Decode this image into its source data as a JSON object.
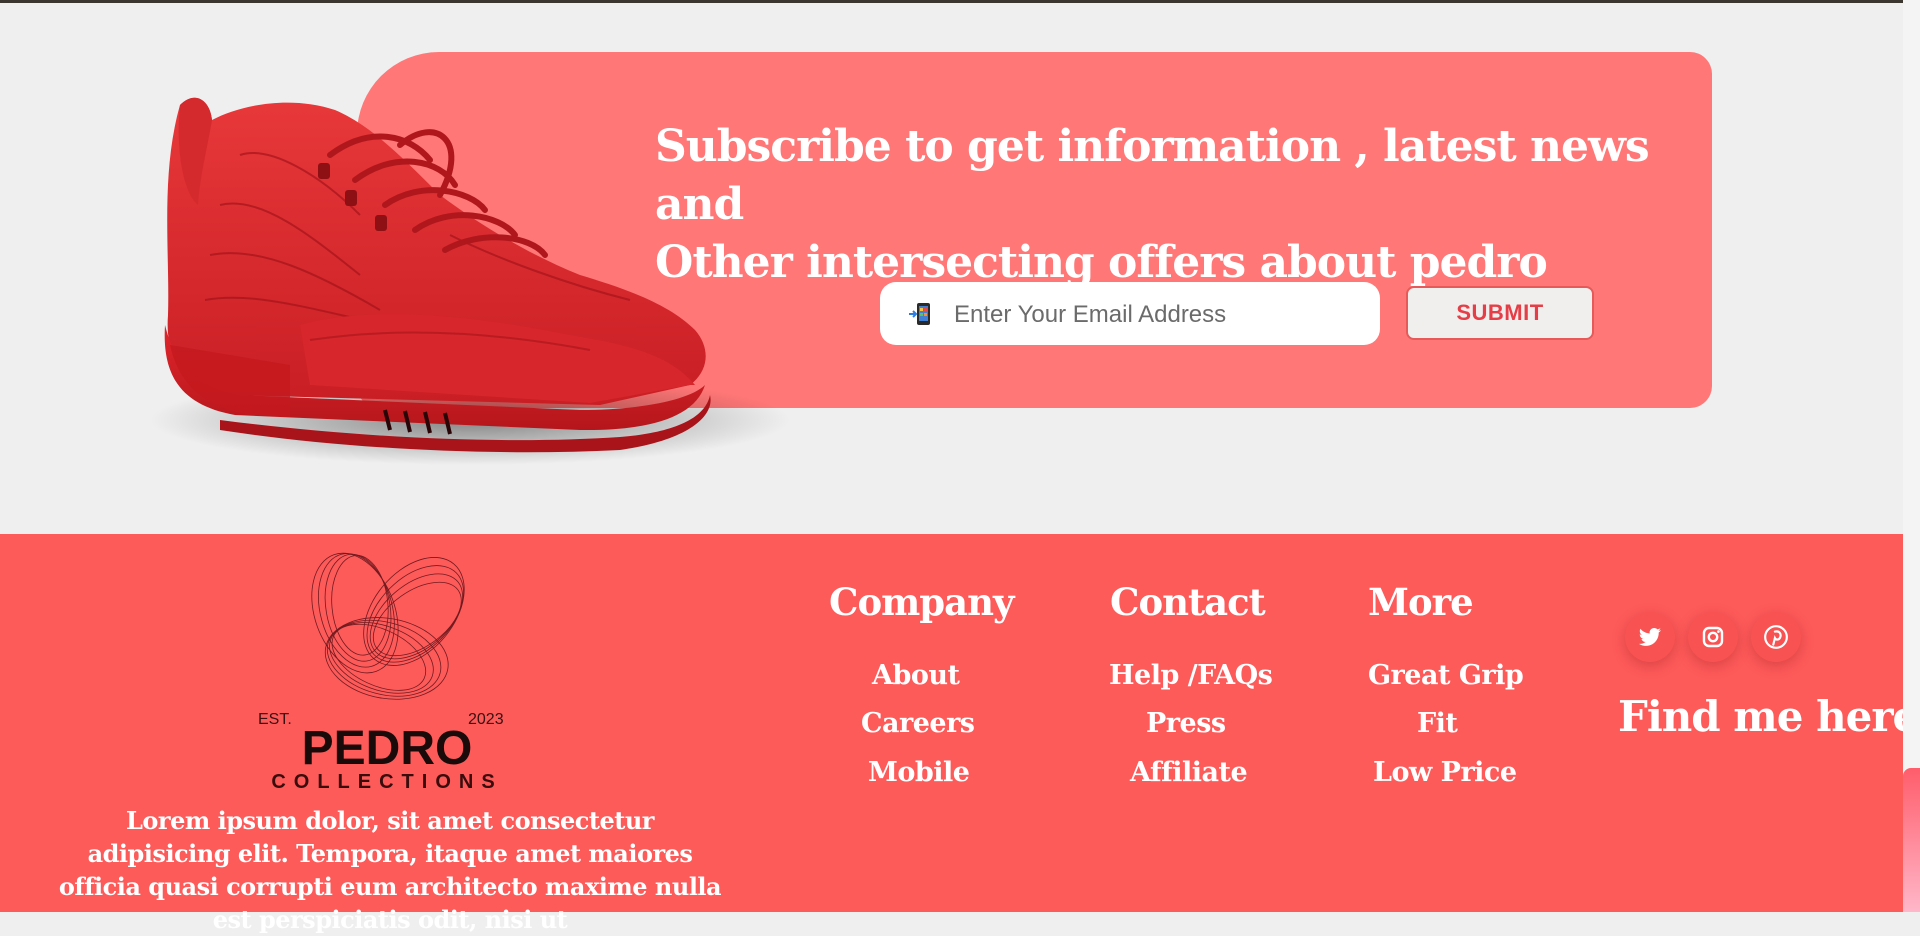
{
  "subscribe": {
    "heading_line1": "Subscribe to get information , latest news and",
    "heading_line2": "Other intersecting offers about pedro",
    "email_placeholder": "Enter Your Email Address",
    "submit_label": "SUBMIT",
    "image": "red-high-top-sneaker",
    "card_color": "#ff7777"
  },
  "footer": {
    "background": "#fd5a5a",
    "logo": {
      "est": "EST.",
      "year": "2023",
      "name": "PEDRO",
      "sub": "COLLECTIONS"
    },
    "description": "Lorem ipsum dolor, sit amet consectetur adipisicing elit. Tempora, itaque amet maiores officia quasi corrupti eum architecto maxime nulla est perspiciatis odit, nisi ut",
    "columns": [
      {
        "title": "Company",
        "links": [
          "About",
          "Careers",
          "Mobile"
        ]
      },
      {
        "title": "Contact",
        "links": [
          "Help /FAQs",
          "Press",
          "Affiliate"
        ]
      },
      {
        "title": "More",
        "links": [
          "Great Grip",
          "Fit",
          "Low Price"
        ]
      }
    ],
    "social_icons": [
      "twitter-icon",
      "instagram-icon",
      "pinterest-icon"
    ],
    "find_me": "Find me here"
  }
}
